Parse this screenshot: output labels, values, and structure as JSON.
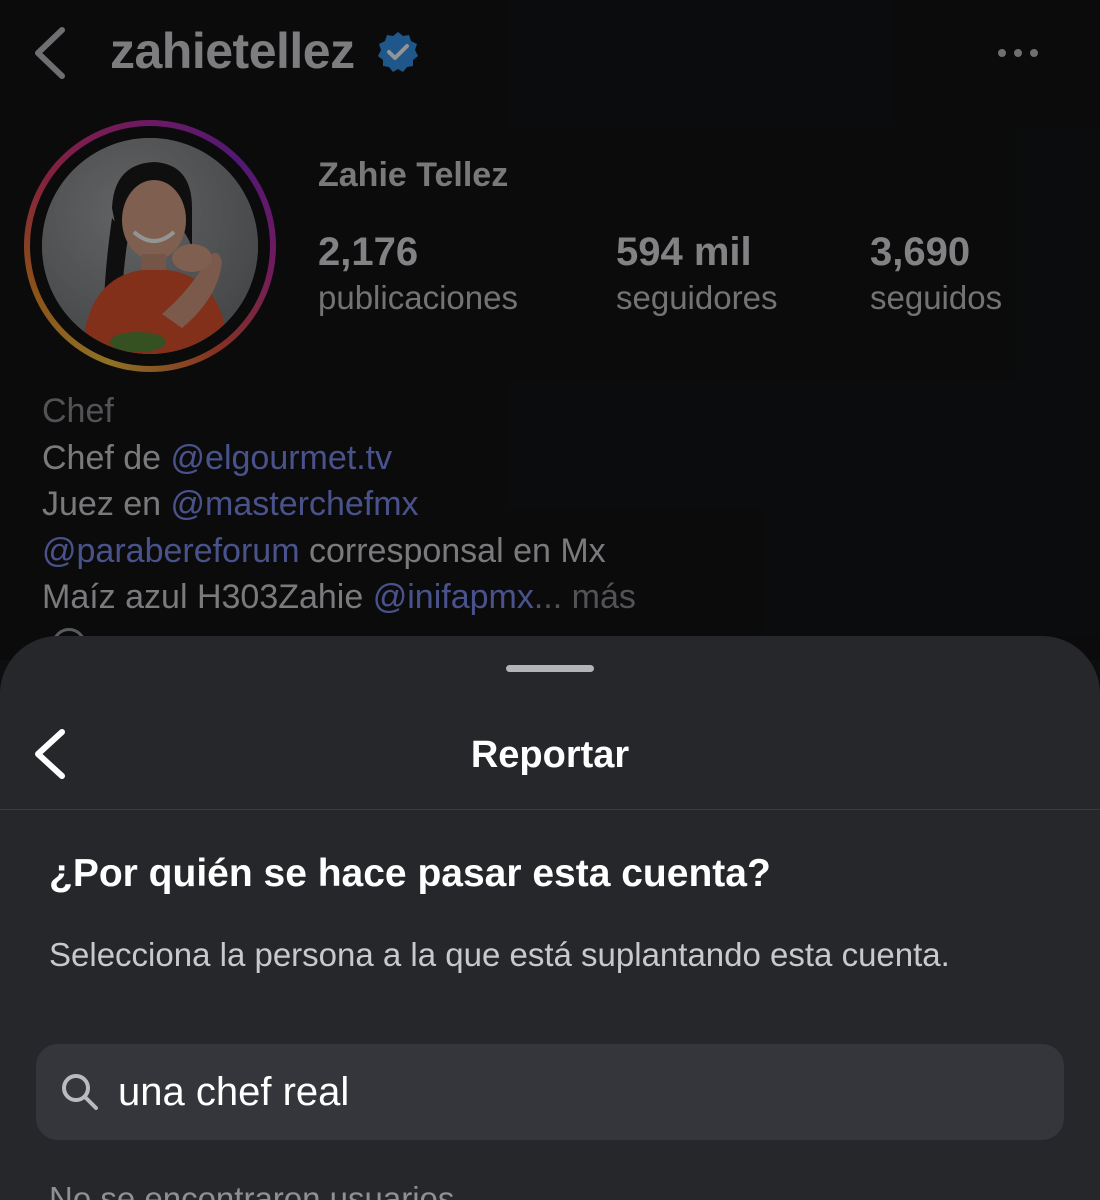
{
  "profile": {
    "username": "zahietellez",
    "display_name": "Zahie Tellez",
    "stats": [
      {
        "value": "2,176",
        "label": "publicaciones"
      },
      {
        "value": "594 mil",
        "label": "seguidores"
      },
      {
        "value": "3,690",
        "label": "seguidos"
      }
    ],
    "bio": {
      "category": "Chef",
      "line1_text": "Chef de ",
      "line1_mention": "@elgourmet.tv",
      "line2_text": "Juez en ",
      "line2_mention": "@masterchefmx",
      "line3_mention": "@parabereforum",
      "line3_text": " corresponsal en Mx",
      "line4_text": "Maíz azul H303Zahie ",
      "line4_mention": "@inifapmx",
      "more": "... más"
    }
  },
  "sheet": {
    "title": "Reportar",
    "question": "¿Por quién se hace pasar esta cuenta?",
    "helper": "Selecciona la persona a la que está suplantando esta cuenta.",
    "search_value": "una chef real",
    "empty_message": "No se encontraron usuarios"
  },
  "colors": {
    "mention": "#7f8ef0",
    "verified": "#3897f0",
    "sheet_bg": "#25272b"
  },
  "icons": [
    "back-arrow-icon",
    "verified-badge-icon",
    "more-options-icon",
    "search-icon"
  ]
}
